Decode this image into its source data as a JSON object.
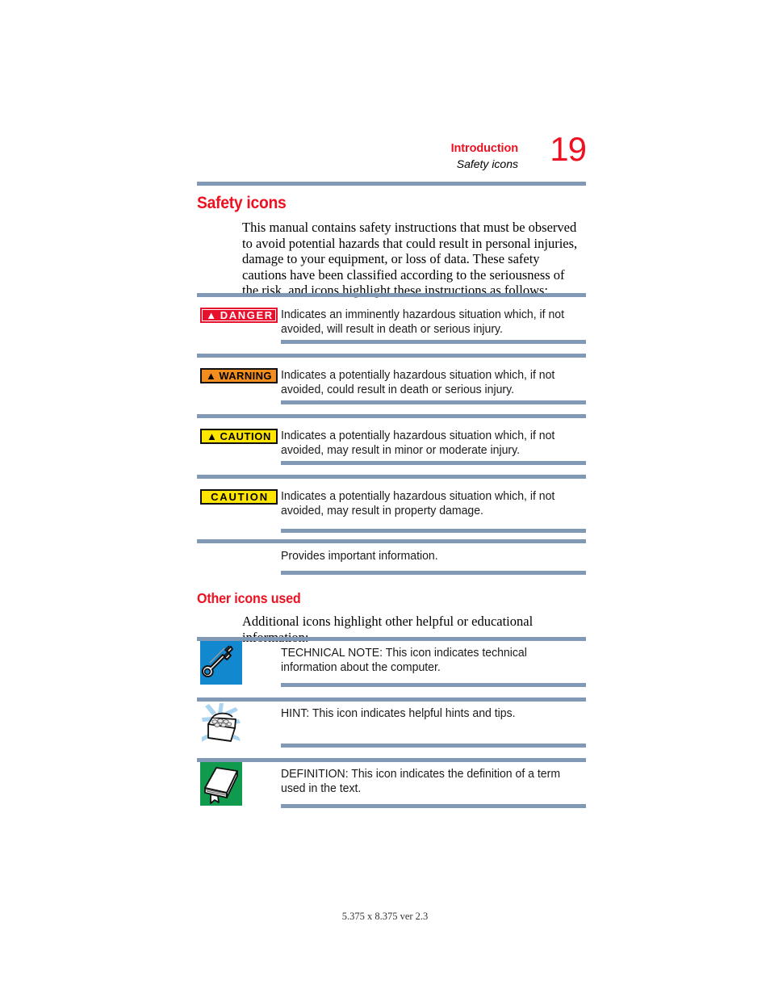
{
  "header": {
    "book_title": "Introduction",
    "section_title": "Safety icons",
    "page_number": "19"
  },
  "colors": {
    "accent_red": "#ee1122",
    "rule_blue": "#8199b4",
    "danger_red": "#e8112d",
    "warning_orange": "#f28d1e",
    "caution_yellow": "#ffe500",
    "tech_note_blue": "#1288ce",
    "hint_blue": "#aad4f0",
    "definition_green": "#109a4e"
  },
  "sections": {
    "safety_icons": {
      "heading": "Safety icons",
      "intro": "This manual contains safety instructions that must be observed to avoid potential hazards that could result in personal injuries, damage to your equipment, or loss of data. These safety cautions have been classified according to the seriousness of the risk, and icons highlight these instructions as follows:",
      "rows": [
        {
          "badge_label": "DANGER",
          "badge_triangle": "▲",
          "badge_style": "danger",
          "description": "Indicates an imminently hazardous situation which, if not avoided, will result in death or serious injury."
        },
        {
          "badge_label": "WARNING",
          "badge_triangle": "▲",
          "badge_style": "warning",
          "description": "Indicates a potentially hazardous situation which, if not avoided, could result in death or serious injury."
        },
        {
          "badge_label": "CAUTION",
          "badge_triangle": "▲",
          "badge_style": "caution",
          "description": "Indicates a potentially hazardous situation which, if not avoided, may result in minor or moderate injury."
        },
        {
          "badge_label": "CAUTION",
          "badge_triangle": "",
          "badge_style": "caution-plain",
          "description": "Indicates a potentially hazardous situation which, if not avoided, may result in property damage."
        },
        {
          "badge_label": "",
          "badge_triangle": "",
          "badge_style": "none",
          "description": "Provides important information."
        }
      ]
    },
    "other_icons": {
      "heading": "Other icons used",
      "intro": "Additional icons highlight other helpful or educational information:",
      "rows": [
        {
          "icon": "wrench-icon",
          "description": "TECHNICAL NOTE: This icon indicates technical information about the computer."
        },
        {
          "icon": "treasure-chest-icon",
          "description": "HINT: This icon indicates helpful hints and tips."
        },
        {
          "icon": "book-icon",
          "description": "DEFINITION: This icon indicates the definition of a term used in the text."
        }
      ]
    }
  },
  "footer": {
    "text": "5.375 x 8.375 ver 2.3"
  }
}
